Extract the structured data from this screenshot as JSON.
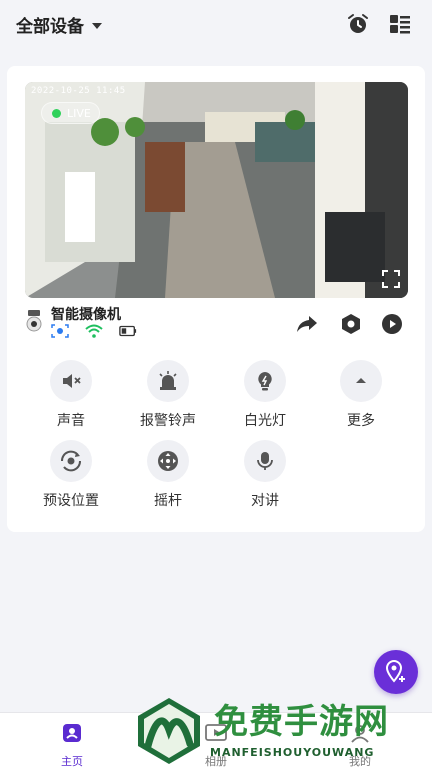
{
  "header": {
    "device_filter_label": "全部设备",
    "icons": [
      "alarm-clock-icon",
      "layout-list-icon"
    ]
  },
  "camera": {
    "timestamp": "2022-10-25 11:45",
    "live_label": "LIVE",
    "name": "智能摄像机",
    "status_icons": [
      "motion-detect-icon",
      "wifi-icon",
      "battery-icon"
    ],
    "action_icons": [
      "share-icon",
      "settings-icon",
      "playback-icon"
    ]
  },
  "controls": [
    {
      "label": "声音",
      "icon": "speaker-mute-icon"
    },
    {
      "label": "报警铃声",
      "icon": "alarm-siren-icon"
    },
    {
      "label": "白光灯",
      "icon": "bulb-icon"
    },
    {
      "label": "更多",
      "icon": "chevron-up-icon"
    },
    {
      "label": "预设位置",
      "icon": "preset-position-icon"
    },
    {
      "label": "摇杆",
      "icon": "joystick-icon"
    },
    {
      "label": "对讲",
      "icon": "microphone-icon"
    }
  ],
  "bottom_nav": [
    {
      "label": "主页",
      "icon": "home-icon",
      "active": true
    },
    {
      "label": "相册",
      "icon": "album-icon",
      "active": false
    },
    {
      "label": "我的",
      "icon": "profile-icon",
      "active": false
    }
  ],
  "watermark": {
    "title": "免费手游网",
    "subtitle": "MANFEISHOUYOUWANG"
  },
  "colors": {
    "accent": "#5a2bd0",
    "fab": "#6a2fd8",
    "live_dot": "#2fd15a",
    "wifi": "#1fbf5f",
    "motion": "#2b7bf0"
  }
}
